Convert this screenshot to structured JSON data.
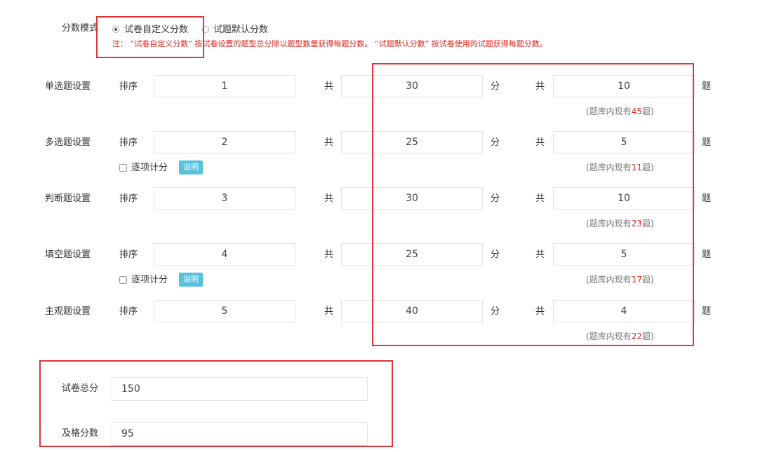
{
  "score_mode": {
    "label": "分数模式",
    "option_custom": "试卷自定义分数",
    "option_default": "试题默认分数",
    "note": "注：   “试卷自定义分数” 按试卷设置的题型总分除以题型数量获得每题分数。   “试题默认分数” 按试卷使用的试题获得每题分数。"
  },
  "labels": {
    "order": "排序",
    "total": "共",
    "points": "分",
    "questions": "题",
    "per_item_scoring": "逐项计分",
    "explain": "说明",
    "avail_prefix": "(题库内现有",
    "avail_suffix": "题)"
  },
  "sections": [
    {
      "name": "单选题设置",
      "order": "1",
      "score": "30",
      "count": "10",
      "available": "45"
    },
    {
      "name": "多选题设置",
      "order": "2",
      "score": "25",
      "count": "5",
      "available": "11"
    },
    {
      "name": "判断题设置",
      "order": "3",
      "score": "30",
      "count": "10",
      "available": "23"
    },
    {
      "name": "填空题设置",
      "order": "4",
      "score": "25",
      "count": "5",
      "available": "17"
    },
    {
      "name": "主观题设置",
      "order": "5",
      "score": "40",
      "count": "4",
      "available": "22"
    }
  ],
  "totals": {
    "total_label": "试卷总分",
    "total_value": "150",
    "pass_label": "及格分数",
    "pass_value": "95"
  }
}
